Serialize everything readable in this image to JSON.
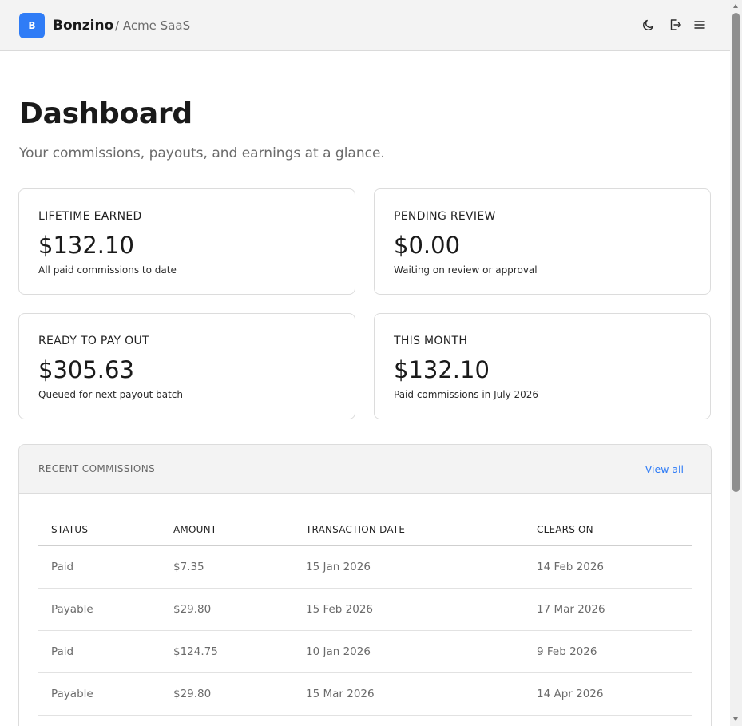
{
  "header": {
    "logo_letter": "B",
    "brand": "Bonzino",
    "breadcrumb": "/ Acme SaaS",
    "icons": [
      "moon-icon",
      "logout-icon",
      "menu-icon"
    ]
  },
  "page": {
    "title": "Dashboard",
    "subtitle": "Your commissions, payouts, and earnings at a glance."
  },
  "cards": [
    {
      "label": "LIFETIME EARNED",
      "value": "$132.10",
      "desc": "All paid commissions to date"
    },
    {
      "label": "PENDING REVIEW",
      "value": "$0.00",
      "desc": "Waiting on review or approval"
    },
    {
      "label": "READY TO PAY OUT",
      "value": "$305.63",
      "desc": "Queued for next payout batch"
    },
    {
      "label": "THIS MONTH",
      "value": "$132.10",
      "desc": "Paid commissions in July 2026"
    }
  ],
  "recent": {
    "title": "RECENT COMMISSIONS",
    "view_all": "View all",
    "columns": [
      "STATUS",
      "AMOUNT",
      "TRANSACTION DATE",
      "CLEARS ON"
    ],
    "rows": [
      [
        "Paid",
        "$7.35",
        "15 Jan 2026",
        "14 Feb 2026"
      ],
      [
        "Payable",
        "$29.80",
        "15 Feb 2026",
        "17 Mar 2026"
      ],
      [
        "Paid",
        "$124.75",
        "10 Jan 2026",
        "9 Feb 2026"
      ],
      [
        "Payable",
        "$29.80",
        "15 Mar 2026",
        "14 Apr 2026"
      ]
    ]
  },
  "colors": {
    "accent": "#2f7cf6",
    "header_bg": "#f3f3f3",
    "muted_text": "#6b6b6b"
  }
}
